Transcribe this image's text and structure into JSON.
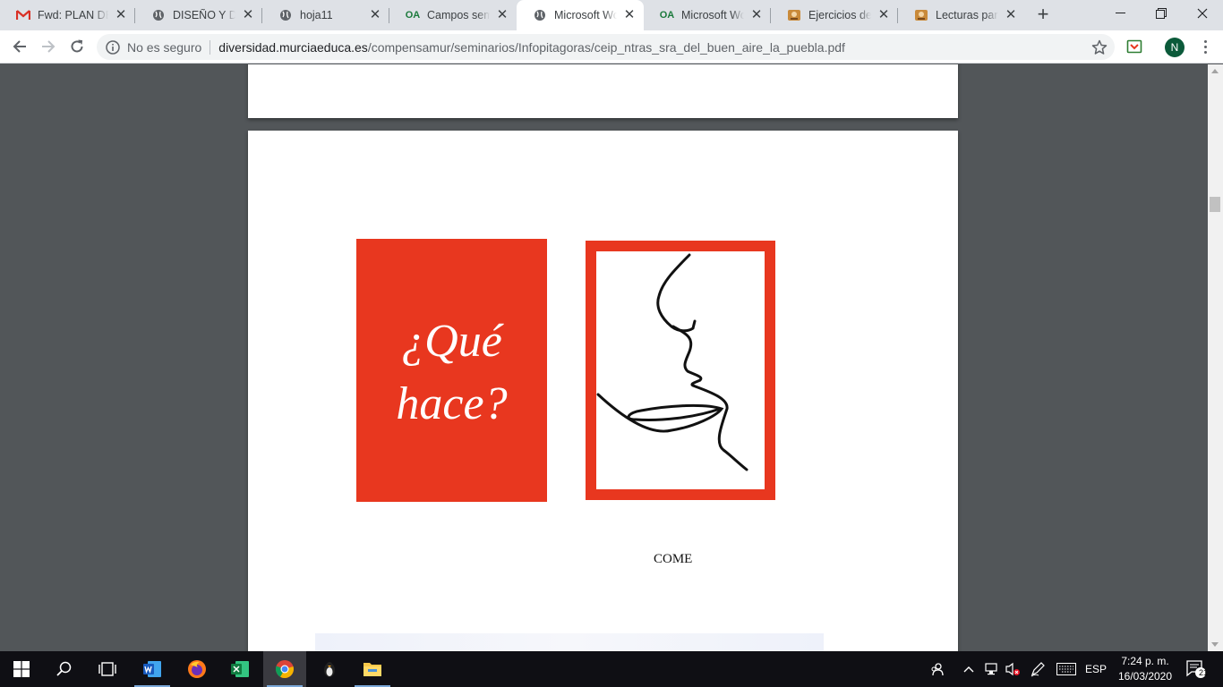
{
  "tabs": [
    {
      "title": "Fwd: PLAN DE",
      "icon": "gmail-icon"
    },
    {
      "title": "DISEÑO Y DES",
      "icon": "globe-icon"
    },
    {
      "title": "hoja11",
      "icon": "globe-icon"
    },
    {
      "title": "Campos semán",
      "icon": "oa-icon",
      "icon_text": "OA"
    },
    {
      "title": "Microsoft Wor",
      "icon": "globe-icon",
      "active": true
    },
    {
      "title": "Microsoft Wor",
      "icon": "oa-icon",
      "icon_text": "OA"
    },
    {
      "title": "Ejercicios de C",
      "icon": "site-icon"
    },
    {
      "title": "Lecturas para l",
      "icon": "site-icon"
    }
  ],
  "omnibox": {
    "security": "No es seguro",
    "host": "diversidad.murciaeduca.es",
    "path": "/compensamur/seminarios/Infopitagoras/ceip_ntras_sra_del_buen_aire_la_puebla.pdf"
  },
  "profile": {
    "initial": "N"
  },
  "document": {
    "card_question_line1": "¿Qué",
    "card_question_line2": "hace?",
    "caption": "COME"
  },
  "taskbar": {
    "language": "ESP",
    "time": "7:24 p. m.",
    "date": "16/03/2020",
    "notifications": "21"
  },
  "colors": {
    "accent_red": "#e8371f",
    "pdf_background": "#525659",
    "taskbar": "#0f0f14"
  }
}
